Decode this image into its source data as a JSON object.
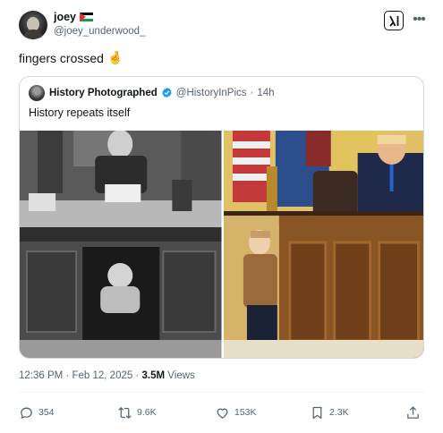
{
  "author": {
    "display_name": "joey",
    "handle": "@joey_underwood_"
  },
  "tweet": {
    "text": "fingers crossed",
    "emoji": "🤞"
  },
  "quote": {
    "author_name": "History Photographed",
    "author_handle": "@HistoryInPics",
    "separator": "·",
    "time": "14h",
    "text": "History repeats itself"
  },
  "meta": {
    "time": "12:36 PM",
    "sep1": "·",
    "date": "Feb 12, 2025",
    "sep2": "·",
    "views": "3.5M",
    "views_label": "Views"
  },
  "actions": {
    "replies": "354",
    "reposts": "9.6K",
    "likes": "153K",
    "bookmarks": "2.3K"
  },
  "colors": {
    "text_primary": "#0f1419",
    "text_secondary": "#536471",
    "verified_blue": "#1d9bf0",
    "border": "#cfd9de"
  },
  "icons": [
    "grok-icon",
    "more-icon",
    "verified-icon",
    "reply-icon",
    "repost-icon",
    "like-icon",
    "bookmark-icon",
    "share-icon"
  ]
}
